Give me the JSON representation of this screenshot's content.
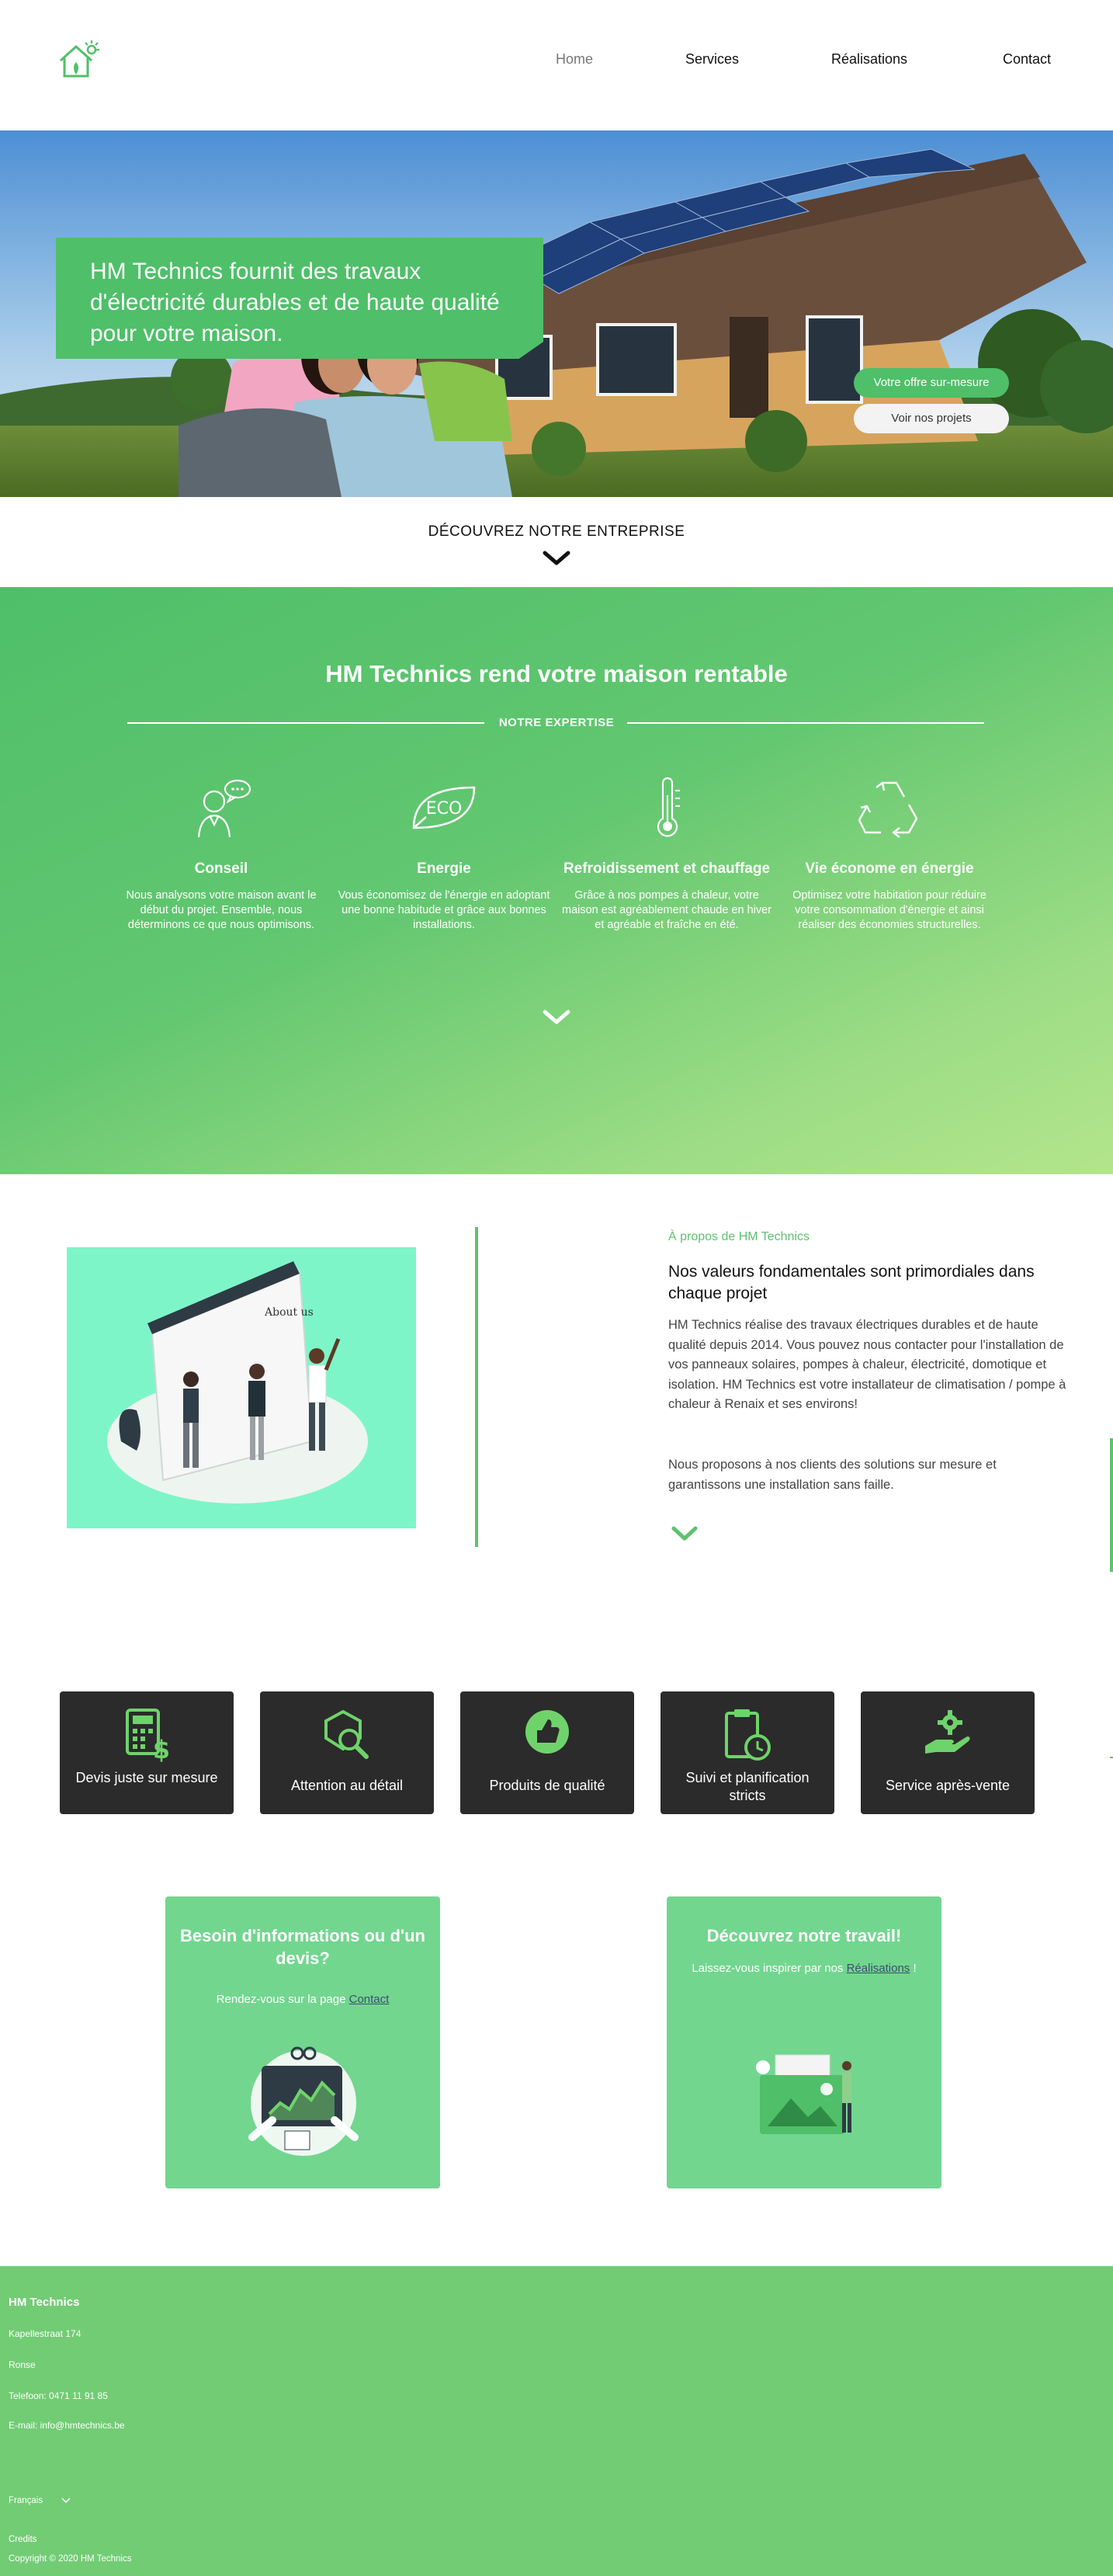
{
  "nav": {
    "home": "Home",
    "services": "Services",
    "realisations": "Réalisations",
    "contact": "Contact"
  },
  "hero": {
    "headline": "HM Technics fournit des travaux d'électricité durables et de haute qualité pour votre maison.",
    "offer_button": "Votre offre sur-mesure",
    "projects_button": "Voir nos projets"
  },
  "discover": {
    "label": "DÉCOUVREZ NOTRE ENTREPRISE"
  },
  "expertise": {
    "title": "HM Technics rend votre maison rentable",
    "subtitle": "NOTRE EXPERTISE",
    "items": [
      {
        "icon": "advisor-icon",
        "title": "Conseil",
        "text": "Nous analysons votre maison avant le début du projet. Ensemble, nous déterminons ce que nous optimisons."
      },
      {
        "icon": "eco-leaf-icon",
        "title": "Energie",
        "text": "Vous économisez de l'énergie en adoptant une bonne habitude et grâce aux bonnes installations."
      },
      {
        "icon": "thermometer-icon",
        "title": "Refroidissement et chauffage",
        "text": "Grâce à nos pompes à chaleur, votre maison est agréablement chaude en hiver et agréable et fraîche en été."
      },
      {
        "icon": "recycle-icon",
        "title": "Vie économe en énergie",
        "text": "Optimisez votre habitation pour réduire votre consommation d'énergie et ainsi réaliser des économies structurelles."
      }
    ]
  },
  "about": {
    "kicker": "À propos de HM Technics",
    "heading": "Nos valeurs fondamentales sont primordiales dans chaque projet",
    "paragraph1": "HM Technics réalise des travaux électriques durables et de haute qualité depuis 2014. Vous pouvez nous contacter pour l'installation de vos panneaux solaires, pompes à chaleur, électricité, domotique et isolation. HM Technics est votre installateur de climatisation / pompe à chaleur à Renaix et ses environs!",
    "paragraph2": "Nous proposons à nos clients des solutions sur mesure et garantissons une installation sans faille.",
    "illustration_text": "About us"
  },
  "features": [
    {
      "icon": "calculator-dollar-icon",
      "label": "Devis juste sur mesure"
    },
    {
      "icon": "magnifier-shield-icon",
      "label": "Attention au détail"
    },
    {
      "icon": "thumbs-up-icon",
      "label": "Produits de qualité"
    },
    {
      "icon": "clipboard-clock-icon",
      "label": "Suivi et planification stricts"
    },
    {
      "icon": "hand-gear-icon",
      "label": "Service après-vente"
    }
  ],
  "cards": {
    "info": {
      "title": "Besoin d'informations ou d'un devis?",
      "text_before": "Rendez-vous sur la page",
      "link": "Contact"
    },
    "work": {
      "title": "Découvrez notre travail!",
      "text_before": "Laissez-vous inspirer par nos",
      "link": "Réalisations",
      "text_after": "!"
    }
  },
  "footer": {
    "company": "HM Technics",
    "address": "Kapellestraat 174",
    "city": "Ronse",
    "phone": "Telefoon: 0471 11 91 85",
    "email": "E-mail: info@hmtechnics.be",
    "language": "Français",
    "credits": "Credits",
    "copyright": "Copyright © 2020 HM Technics"
  },
  "colors": {
    "brand_green": "#4fbf69",
    "card_green": "#72d68f",
    "footer_green": "#72cc74",
    "feature_dark": "#2b2b2b",
    "illustration_mint": "#7ef5c9"
  }
}
